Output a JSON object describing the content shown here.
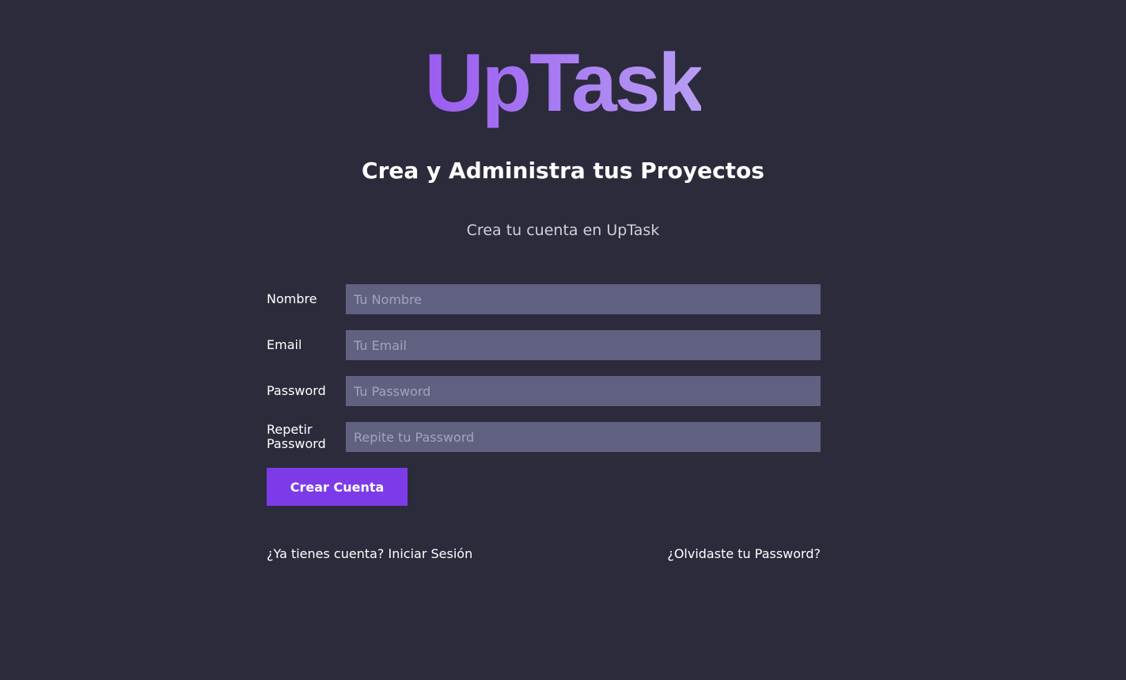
{
  "app": {
    "logo": "UpTask",
    "tagline": "Crea y Administra tus Proyectos",
    "subtitle": "Crea tu cuenta en UpTask"
  },
  "form": {
    "fields": [
      {
        "label": "Nombre",
        "placeholder": "Tu Nombre"
      },
      {
        "label": "Email",
        "placeholder": "Tu Email"
      },
      {
        "label": "Password",
        "placeholder": "Tu Password"
      },
      {
        "label": "Repetir Password",
        "placeholder": "Repite tu Password"
      }
    ],
    "submit_label": "Crear Cuenta"
  },
  "links": {
    "login": "¿Ya tienes cuenta? Iniciar Sesión",
    "forgot": "¿Olvidaste tu Password?"
  },
  "colors": {
    "background": "#2c2b3b",
    "input_background": "#606080",
    "accent": "#7d3be8",
    "logo_gradient_start": "#9b5cf1",
    "logo_gradient_end": "#b79df3"
  }
}
